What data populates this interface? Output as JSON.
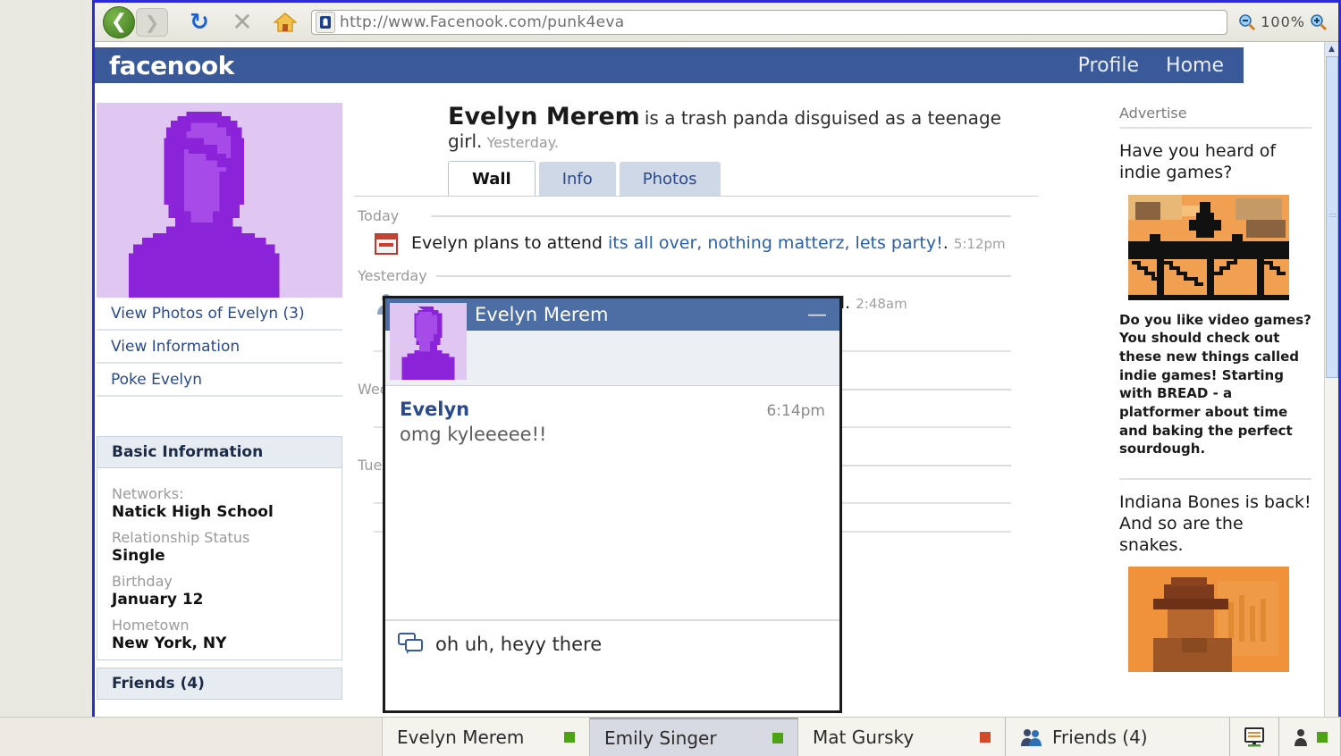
{
  "browser": {
    "url": "http://www.Facenook.com/punk4eva",
    "zoom_level": "100%",
    "back_icon": "back-arrow-icon",
    "forward_icon": "forward-arrow-icon",
    "reload_icon": "reload-icon",
    "stop_icon": "stop-icon",
    "home_icon": "home-icon",
    "security_icon": "security-lock-icon",
    "zoom_out_icon": "zoom-out-icon",
    "zoom_in_icon": "zoom-in-icon"
  },
  "site": {
    "logo": "facenook",
    "nav": [
      {
        "label": "Profile"
      },
      {
        "label": "Home"
      }
    ]
  },
  "profile": {
    "name": "Evelyn Merem",
    "status": "is a trash panda disguised as a teenage girl.",
    "status_time": "Yesterday.",
    "tabs": [
      {
        "label": "Wall",
        "active": true
      },
      {
        "label": "Info",
        "active": false
      },
      {
        "label": "Photos",
        "active": false
      }
    ],
    "links": [
      {
        "label": "View Photos of Evelyn (3)"
      },
      {
        "label": "View Information"
      },
      {
        "label": "Poke Evelyn"
      }
    ],
    "basic_information": {
      "heading": "Basic Information",
      "fields": [
        {
          "label": "Networks:",
          "value": "Natick High School"
        },
        {
          "label": "Relationship Status",
          "value": "Single"
        },
        {
          "label": "Birthday",
          "value": "January 12"
        },
        {
          "label": "Hometown",
          "value": "New York, NY"
        }
      ]
    },
    "friends_heading": "Friends (4)"
  },
  "wall": {
    "days": [
      {
        "label": "Today"
      },
      {
        "label": "Yesterday"
      },
      {
        "label": "Wedn"
      },
      {
        "label": "Tuesd"
      }
    ],
    "posts": [
      {
        "prefix": "Evelyn plans to attend ",
        "link": "its all over, nothing matterz, lets party!",
        "suffix": ".",
        "time": "5:12pm",
        "icon": "calendar-event-icon"
      },
      {
        "prefix": "Evelyn is a trash panda disguised as a teenage girl.",
        "link": "",
        "suffix": "",
        "time": "2:48am",
        "icon": "person-icon"
      }
    ]
  },
  "ads": {
    "heading": "Advertise",
    "items": [
      {
        "title": "Have you heard of indie games?",
        "body": "Do you like video games? You should check out these new things called indie games! Starting with BREAD - a platformer about time and baking the perfect sourdough.",
        "image": "pixel-art-bridge-sunset"
      },
      {
        "title": "Indiana Bones is back! And so are the snakes.",
        "body": "",
        "image": "pixel-art-adventurer-hat"
      }
    ]
  },
  "chat_window": {
    "title": "Evelyn Merem",
    "minimize_icon": "minimize-icon",
    "avatar": "evelyn-avatar",
    "message": {
      "sender": "Evelyn",
      "time": "6:14pm",
      "text": "omg kyleeeee!!"
    },
    "input_value": "oh uh, heyy there",
    "input_icon": "chat-bubbles-icon"
  },
  "taskbar": {
    "chats": [
      {
        "name": "Evelyn Merem",
        "status": "green",
        "active": false
      },
      {
        "name": "Emily Singer",
        "status": "green",
        "active": true
      },
      {
        "name": "Mat Gursky",
        "status": "red",
        "active": false
      }
    ],
    "friends": {
      "label": "Friends (4)",
      "icon": "friends-group-icon"
    },
    "notifications_icon": "notifications-board-icon",
    "user_icon": "user-status-icon",
    "user_status": "green"
  },
  "colors": {
    "facebook_blue": "#3a5998",
    "chat_header_blue": "#4c6ea5",
    "link_blue": "#2b4a8b",
    "online_green": "#4ea216",
    "busy_red": "#d34a2a",
    "avatar_purple": "#8b23d9",
    "browser_border": "#2b2bd6"
  }
}
